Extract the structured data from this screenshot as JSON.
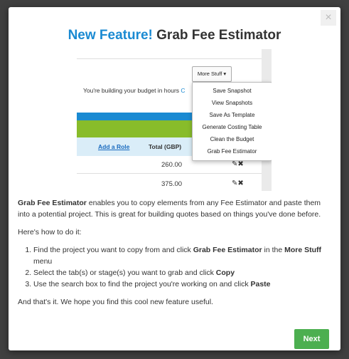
{
  "modal": {
    "close_glyph": "×",
    "title_accent": "New Feature!",
    "title_rest": " Grab Fee Estimator",
    "preview": {
      "more_stuff": "More Stuff ▾",
      "budget_text": "You're building your budget in hours",
      "budget_link_char": "C",
      "add_role": "Add a Role",
      "total_header": "Total (GBP)",
      "row_values": [
        "260.00",
        "375.00"
      ],
      "row_action_glyph": "✎✖",
      "menu_items": [
        "Save Snapshot",
        "View Snapshots",
        "Save As Template",
        "Generate Costing Table",
        "Clean the Budget",
        "Grab Fee Estimator"
      ],
      "colors": {
        "blue": "#1a8ad2",
        "green": "#88bc2a"
      }
    },
    "intro_bold": "Grab Fee Estimator",
    "intro_rest": " enables you to copy elements from any Fee Estimator and paste them into a potential project. This is great for building quotes based on things you've done before.",
    "howto": "Here's how to do it:",
    "steps": [
      {
        "pre": "Find the project you want to copy from and click ",
        "b1": "Grab Fee Estimator",
        "mid": " in the ",
        "b2": "More Stuff",
        "post": " menu"
      },
      {
        "pre": "Select the tab(s) or stage(s) you want to grab and click ",
        "b1": "Copy"
      },
      {
        "pre": "Use the search box to find the project you're working on and click ",
        "b1": "Paste"
      }
    ],
    "outro": "And that's it. We hope you find this cool new feature useful.",
    "next_label": "Next",
    "next_color": "#4caf50"
  }
}
